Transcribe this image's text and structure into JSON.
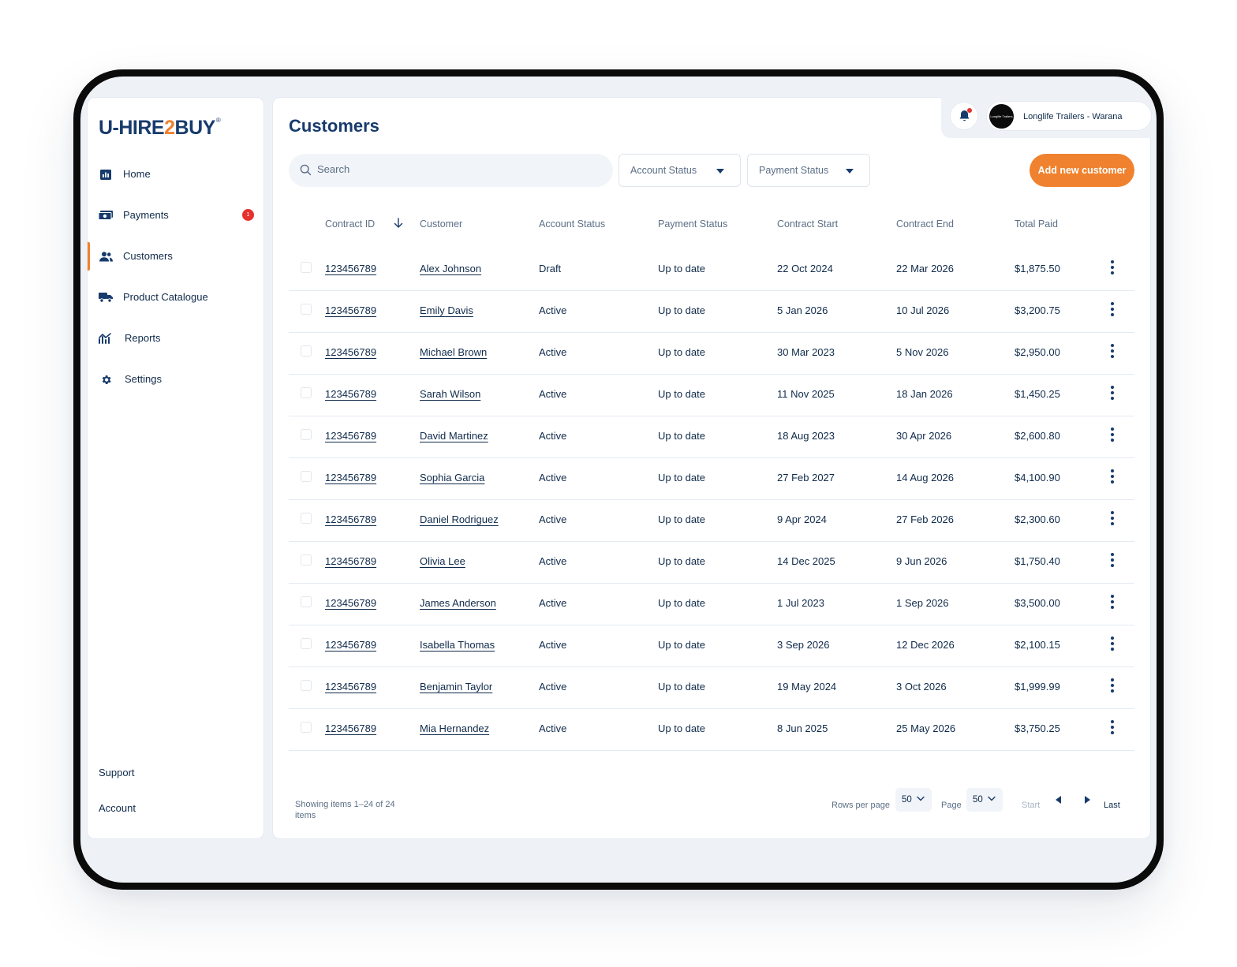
{
  "brand": {
    "logo_part1": "U-HIRE",
    "logo_part2": "2",
    "logo_part3": "BUY",
    "logo_mark": "®",
    "accent_color": "#f0822f",
    "primary_color": "#173b6c"
  },
  "sidebar": {
    "items": [
      {
        "label": "Home",
        "icon": "chart-icon"
      },
      {
        "label": "Payments",
        "icon": "cash-icon",
        "badge": "1"
      },
      {
        "label": "Customers",
        "icon": "users-icon",
        "active": true
      },
      {
        "label": "Product Catalogue",
        "icon": "truck-icon"
      },
      {
        "label": "Reports",
        "icon": "trend-icon"
      },
      {
        "label": "Settings",
        "icon": "gear-icon"
      }
    ],
    "support_label": "Support",
    "account_label": "Account"
  },
  "header": {
    "account_name": "Longlife Trailers - Warana",
    "avatar_text": "Longlife Trailers"
  },
  "page": {
    "title": "Customers",
    "search_placeholder": "Search",
    "account_status_filter": "Account Status",
    "payment_status_filter": "Payment Status",
    "add_button": "Add new customer"
  },
  "table": {
    "columns": [
      "Contract  ID",
      "Customer",
      "Account Status",
      "Payment Status",
      "Contract Start",
      "Contract End",
      "Total Paid"
    ],
    "rows": [
      {
        "id": "123456789",
        "customer": "Alex Johnson",
        "account": "Draft",
        "payment": "Up to date",
        "start": "22 Oct 2024",
        "end": "22 Mar 2026",
        "paid": "$1,875.50"
      },
      {
        "id": "123456789",
        "customer": "Emily Davis",
        "account": "Active",
        "payment": "Up to date",
        "start": "5 Jan 2026",
        "end": "10 Jul 2026",
        "paid": "$3,200.75"
      },
      {
        "id": "123456789",
        "customer": "Michael Brown",
        "account": "Active",
        "payment": "Up to date",
        "start": "30 Mar 2023",
        "end": "5 Nov 2026",
        "paid": "$2,950.00"
      },
      {
        "id": "123456789",
        "customer": "Sarah Wilson",
        "account": "Active",
        "payment": "Up to date",
        "start": "11 Nov 2025",
        "end": "18 Jan 2026",
        "paid": "$1,450.25"
      },
      {
        "id": "123456789",
        "customer": "David Martinez",
        "account": "Active",
        "payment": "Up to date",
        "start": "18 Aug 2023",
        "end": "30 Apr 2026",
        "paid": "$2,600.80"
      },
      {
        "id": "123456789",
        "customer": "Sophia Garcia",
        "account": "Active",
        "payment": "Up to date",
        "start": "27 Feb 2027",
        "end": "14 Aug 2026",
        "paid": "$4,100.90"
      },
      {
        "id": "123456789",
        "customer": "Daniel Rodriguez",
        "account": "Active",
        "payment": "Up to date",
        "start": "9 Apr 2024",
        "end": "27 Feb 2026",
        "paid": "$2,300.60"
      },
      {
        "id": "123456789",
        "customer": "Olivia Lee",
        "account": "Active",
        "payment": "Up to date",
        "start": "14 Dec 2025",
        "end": "9 Jun 2026",
        "paid": "$1,750.40"
      },
      {
        "id": "123456789",
        "customer": "James Anderson",
        "account": "Active",
        "payment": "Up to date",
        "start": "1 Jul 2023",
        "end": "1 Sep 2026",
        "paid": "$3,500.00"
      },
      {
        "id": "123456789",
        "customer": "Isabella Thomas",
        "account": "Active",
        "payment": "Up to date",
        "start": "3 Sep 2026",
        "end": "12 Dec 2026",
        "paid": "$2,100.15"
      },
      {
        "id": "123456789",
        "customer": "Benjamin Taylor",
        "account": "Active",
        "payment": "Up to date",
        "start": "19 May 2024",
        "end": "3 Oct 2026",
        "paid": "$1,999.99"
      },
      {
        "id": "123456789",
        "customer": "Mia Hernandez",
        "account": "Active",
        "payment": "Up to date",
        "start": "8 Jun 2025",
        "end": "25 May 2026",
        "paid": "$3,750.25"
      }
    ]
  },
  "pagination": {
    "showing": "Showing items 1–24 of 24 items",
    "rows_per_page_label": "Rows per page",
    "rows_per_page_value": "50",
    "page_label": "Page",
    "page_value": "50",
    "start_label": "Start",
    "last_label": "Last"
  }
}
